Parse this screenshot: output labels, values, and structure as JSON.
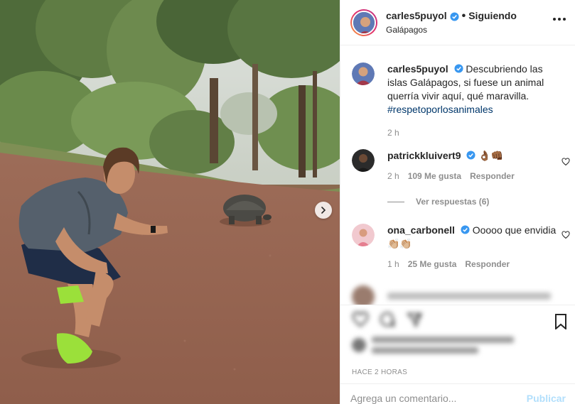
{
  "post": {
    "author": "carles5puyol",
    "follow_status": "Siguiendo",
    "location": "Galápagos",
    "caption": {
      "username": "carles5puyol",
      "text": "Descubriendo las islas Galápagos, si fuese un animal querría vivir aquí, qué maravilla.",
      "hashtag": "#respetoporlosanimales",
      "age": "2 h"
    },
    "timestamp": "HACE 2 HORAS"
  },
  "comments": [
    {
      "username": "patrickkluivert9",
      "text": "👌🏾👊🏾",
      "age": "2 h",
      "likes": "109 Me gusta",
      "reply": "Responder",
      "view_replies": "Ver respuestas (6)"
    },
    {
      "username": "ona_carbonell",
      "text": "Ooooo que envidia 👏🏼👏🏼",
      "age": "1 h",
      "likes": "25 Me gusta",
      "reply": "Responder"
    }
  ],
  "composer": {
    "placeholder": "Agrega un comentario...",
    "publish": "Publicar"
  },
  "icons": {
    "verified": "verified-badge-icon",
    "heart": "heart-icon",
    "more": "more-options-icon",
    "bookmark": "bookmark-icon",
    "next": "chevron-right-icon"
  },
  "colors": {
    "text": "#262626",
    "secondary": "#8e8e8e",
    "verified": "#3897f0",
    "hashtag": "#00376b",
    "publish_disabled": "#b2dffc"
  }
}
